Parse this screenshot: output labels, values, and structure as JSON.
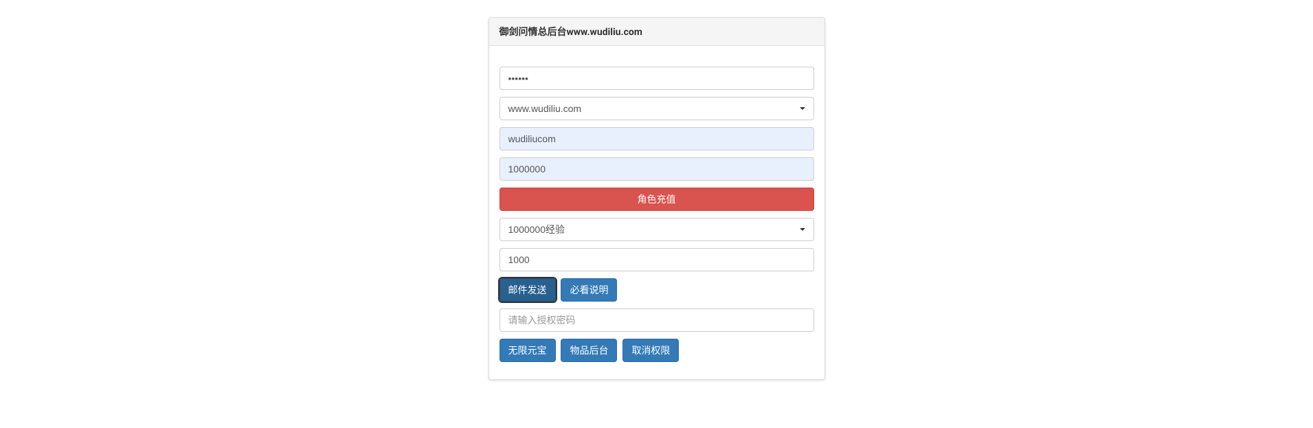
{
  "header": {
    "title": "御剑问情总后台www.wudiliu.com"
  },
  "form": {
    "password_value": "••••••",
    "server_dropdown": "www.wudiliu.com",
    "username_value": "wudiliucom",
    "amount_value": "1000000",
    "recharge_button": "角色充值",
    "reward_dropdown": "1000000经验",
    "quantity_value": "1000",
    "send_mail_button": "邮件发送",
    "instructions_button": "必看说明",
    "auth_password_placeholder": "请输入授权密码",
    "unlimited_gold_button": "无限元宝",
    "item_backend_button": "物品后台",
    "cancel_permission_button": "取消权限"
  }
}
